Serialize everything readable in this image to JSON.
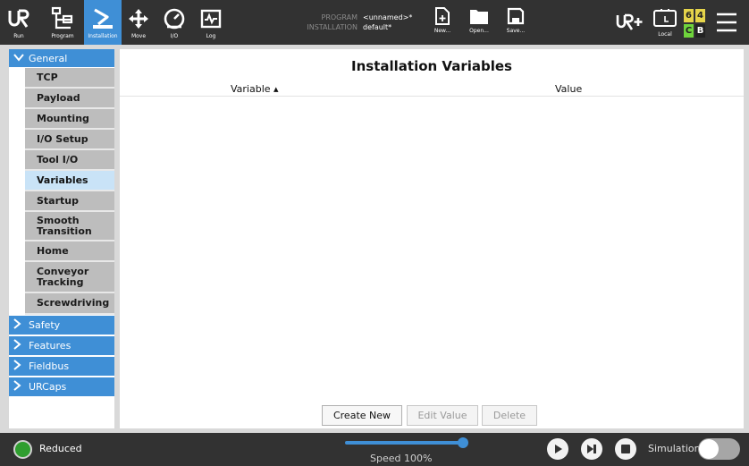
{
  "topbar": {
    "buttons": [
      {
        "label": "Run",
        "icon": "ur-logo-icon"
      },
      {
        "label": "Program",
        "icon": "program-tree-icon"
      },
      {
        "label": "Installation",
        "icon": "installation-robot-arm-icon"
      },
      {
        "label": "Move",
        "icon": "move-arrows-icon"
      },
      {
        "label": "I/O",
        "icon": "io-gauge-icon"
      },
      {
        "label": "Log",
        "icon": "log-pulse-icon"
      }
    ],
    "program_label": "PROGRAM",
    "program_value": "<unnamed>*",
    "installation_label": "INSTALLATION",
    "installation_value": "default*",
    "file_buttons": [
      {
        "label": "New...",
        "icon": "new-file-icon"
      },
      {
        "label": "Open...",
        "icon": "open-folder-icon"
      },
      {
        "label": "Save...",
        "icon": "save-disk-icon"
      }
    ],
    "local_label": "Local",
    "badges": {
      "top_left": "6",
      "top_right": "4",
      "bottom_left": "C",
      "bottom_right": "B"
    },
    "colors": {
      "bar": "#323232",
      "active": "#3f8fd6",
      "badge_yellow": "#e5d44a",
      "badge_green": "#6fd43c",
      "badge_dark": "#222222"
    }
  },
  "sidebar": {
    "general": {
      "label": "General",
      "expanded": true
    },
    "items": [
      {
        "label": "TCP"
      },
      {
        "label": "Payload"
      },
      {
        "label": "Mounting"
      },
      {
        "label": "I/O Setup"
      },
      {
        "label": "Tool I/O"
      },
      {
        "label": "Variables",
        "selected": true
      },
      {
        "label": "Startup"
      },
      {
        "label": "Smooth Transition"
      },
      {
        "label": "Home"
      },
      {
        "label": "Conveyor Tracking"
      },
      {
        "label": "Screwdriving"
      }
    ],
    "categories": [
      {
        "label": "Safety"
      },
      {
        "label": "Features"
      },
      {
        "label": "Fieldbus"
      },
      {
        "label": "URCaps"
      }
    ]
  },
  "main": {
    "title": "Installation Variables",
    "columns": {
      "variable": "Variable ▴",
      "value": "Value"
    },
    "rows": [],
    "buttons": {
      "create": "Create New",
      "edit": "Edit Value",
      "delete": "Delete"
    }
  },
  "bottombar": {
    "status": "Reduced",
    "speed_label": "Speed 100%",
    "speed_value": 100,
    "simulation_label": "Simulation",
    "simulation_on": false
  }
}
